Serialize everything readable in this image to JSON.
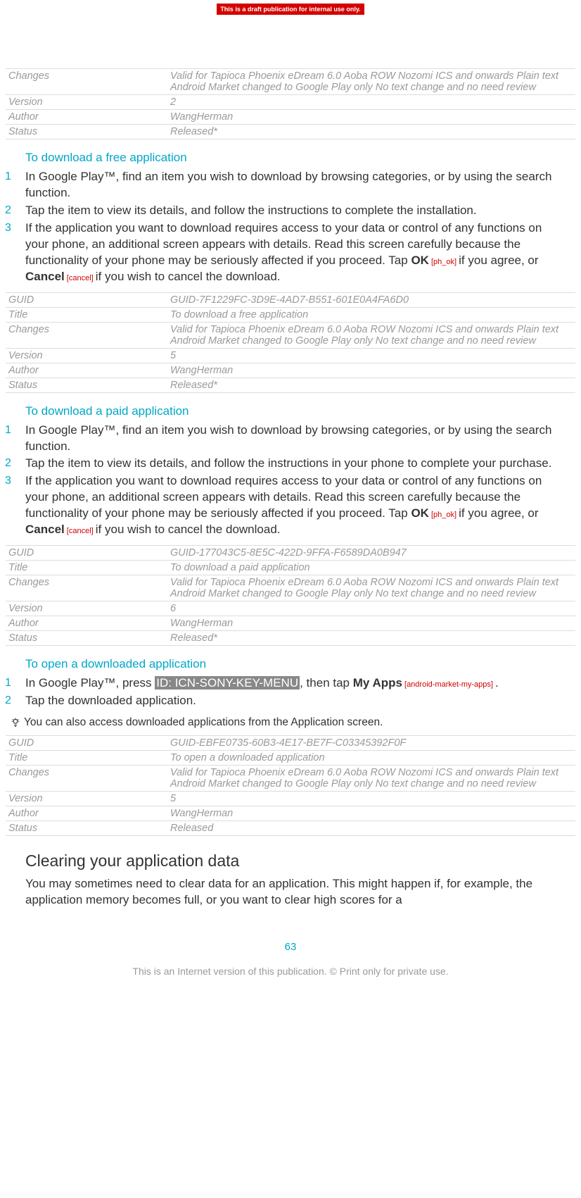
{
  "banner": "This is a draft publication for internal use only.",
  "meta_top": {
    "rows": [
      {
        "k": "Changes",
        "v": "Valid for Tapioca Phoenix eDream 6.0 Aoba ROW Nozomi ICS and onwards Plain text Android Market changed to Google Play only No text change and no need review"
      },
      {
        "k": "Version",
        "v": "2"
      },
      {
        "k": "Author",
        "v": "WangHerman"
      },
      {
        "k": "Status",
        "v": "Released*"
      }
    ]
  },
  "sec_free": {
    "title": "To download a free application",
    "step1": "In Google Play™, find an item you wish to download by browsing categories, or by using the search function.",
    "step2": "Tap the item to view its details, and follow the instructions to complete the installation.",
    "step3_a": "If the application you want to download requires access to your data or control of any functions on your phone, an additional screen appears with details. Read this screen carefully because the functionality of your phone may be seriously affected if you proceed. Tap ",
    "ok": "OK",
    "ok_tag": " [ph_ok] ",
    "step3_b": "if you agree, or ",
    "cancel": "Cancel",
    "cancel_tag": " [cancel] ",
    "step3_c": "if you wish to cancel the download.",
    "meta": {
      "rows": [
        {
          "k": "GUID",
          "v": "GUID-7F1229FC-3D9E-4AD7-B551-601E0A4FA6D0"
        },
        {
          "k": "Title",
          "v": "To download a free application"
        },
        {
          "k": "Changes",
          "v": "Valid for Tapioca Phoenix eDream 6.0 Aoba ROW Nozomi ICS and onwards Plain text Android Market changed to Google Play only No text change and no need review"
        },
        {
          "k": "Version",
          "v": "5"
        },
        {
          "k": "Author",
          "v": "WangHerman"
        },
        {
          "k": "Status",
          "v": "Released*"
        }
      ]
    }
  },
  "sec_paid": {
    "title": "To download a paid application",
    "step1": "In Google Play™, find an item you wish to download by browsing categories, or by using the search function.",
    "step2": "Tap the item to view its details, and follow the instructions in your phone to complete your purchase.",
    "step3_a": "If the application you want to download requires access to your data or control of any functions on your phone, an additional screen appears with details. Read this screen carefully because the functionality of your phone may be seriously affected if you proceed. Tap ",
    "ok": "OK",
    "ok_tag": " [ph_ok] ",
    "step3_b": "if you agree, or ",
    "cancel": "Cancel",
    "cancel_tag": " [cancel] ",
    "step3_c": "if you wish to cancel the download.",
    "meta": {
      "rows": [
        {
          "k": "GUID",
          "v": "GUID-177043C5-8E5C-422D-9FFA-F6589DA0B947"
        },
        {
          "k": "Title",
          "v": "To download a paid application"
        },
        {
          "k": "Changes",
          "v": "Valid for Tapioca Phoenix eDream 6.0 Aoba ROW Nozomi ICS and onwards Plain text Android Market changed to Google Play only No text change and no need review"
        },
        {
          "k": "Version",
          "v": "6"
        },
        {
          "k": "Author",
          "v": "WangHerman"
        },
        {
          "k": "Status",
          "v": "Released*"
        }
      ]
    }
  },
  "sec_open": {
    "title": "To open a downloaded application",
    "step1_a": "In Google Play™, press ",
    "step1_hl": "ID: ICN-SONY-KEY-MENU",
    "step1_b": ", then tap ",
    "myapps": "My Apps",
    "myapps_tag": " [android-market-my-apps] ",
    "step1_c": ".",
    "step2": "Tap the downloaded application.",
    "tip": "You can also access downloaded applications from the Application screen.",
    "meta": {
      "rows": [
        {
          "k": "GUID",
          "v": "GUID-EBFE0735-60B3-4E17-BE7F-C03345392F0F"
        },
        {
          "k": "Title",
          "v": "To open a downloaded application"
        },
        {
          "k": "Changes",
          "v": "Valid for Tapioca Phoenix eDream 6.0 Aoba ROW Nozomi ICS and onwards Plain text Android Market changed to Google Play only No text change and no need review"
        },
        {
          "k": "Version",
          "v": "5"
        },
        {
          "k": "Author",
          "v": "WangHerman"
        },
        {
          "k": "Status",
          "v": "Released"
        }
      ]
    }
  },
  "clearing": {
    "heading": "Clearing your application data",
    "para": "You may sometimes need to clear data for an application. This might happen if, for example, the application memory becomes full, or you want to clear high scores for a"
  },
  "nums": {
    "n1": "1",
    "n2": "2",
    "n3": "3"
  },
  "page_number": "63",
  "footer": "This is an Internet version of this publication. © Print only for private use."
}
